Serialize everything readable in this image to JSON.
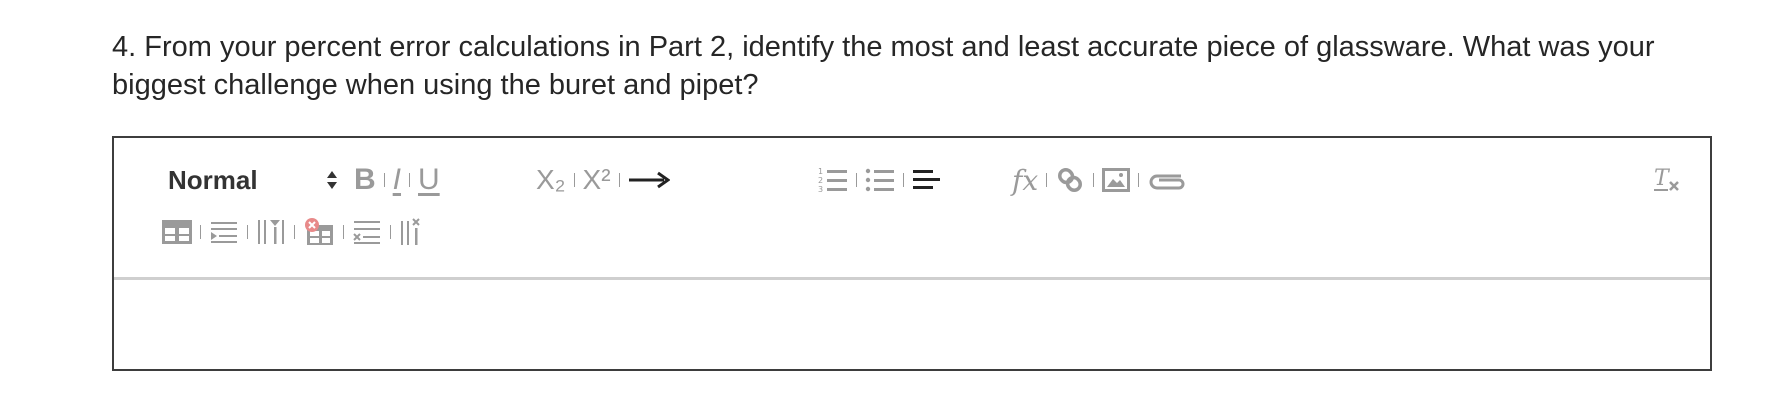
{
  "question": {
    "text": "4. From your percent error calculations in Part 2, identify the most and least accurate piece of glassware. What was your biggest challenge when using the buret and pipet?"
  },
  "toolbar": {
    "format_select": {
      "selected": "Normal"
    },
    "bold_label": "B",
    "italic_label": "I",
    "underline_label": "U",
    "subscript_label": "X₂",
    "superscript_label": "X²",
    "arrow_label": "⟶",
    "formula_label": "fx"
  },
  "editor": {
    "content": ""
  }
}
